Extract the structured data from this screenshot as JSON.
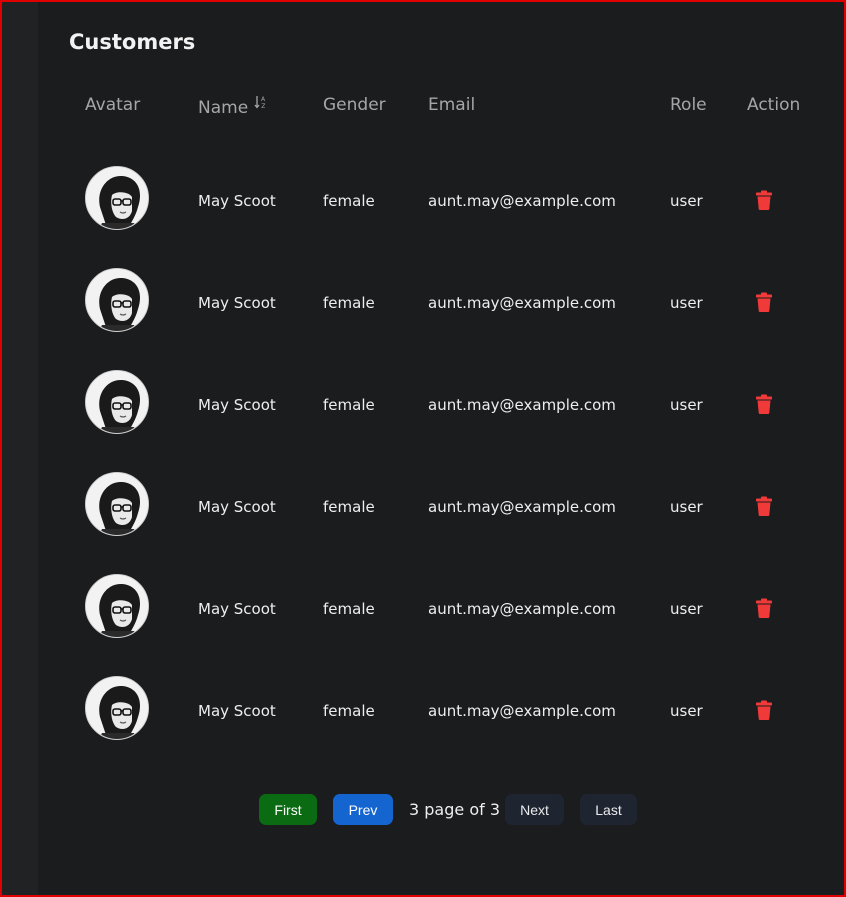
{
  "page": {
    "title": "Customers"
  },
  "table": {
    "headers": [
      "Avatar",
      "Name",
      "Gender",
      "Email",
      "Role",
      "Action"
    ],
    "rows": [
      {
        "name": "May Scoot",
        "gender": "female",
        "email": "aunt.may@example.com",
        "role": "user"
      },
      {
        "name": "May Scoot",
        "gender": "female",
        "email": "aunt.may@example.com",
        "role": "user"
      },
      {
        "name": "May Scoot",
        "gender": "female",
        "email": "aunt.may@example.com",
        "role": "user"
      },
      {
        "name": "May Scoot",
        "gender": "female",
        "email": "aunt.may@example.com",
        "role": "user"
      },
      {
        "name": "May Scoot",
        "gender": "female",
        "email": "aunt.may@example.com",
        "role": "user"
      },
      {
        "name": "May Scoot",
        "gender": "female",
        "email": "aunt.may@example.com",
        "role": "user"
      }
    ]
  },
  "pagination": {
    "first_label": "First",
    "prev_label": "Prev",
    "info": "3 page of 3",
    "next_label": "Next",
    "last_label": "Last"
  },
  "icons": {
    "sort": "sort-alpha-icon",
    "delete": "trash-icon"
  },
  "colors": {
    "background": "#1b1c1e",
    "delete": "#f03a3a",
    "first_button": "#0a6b12",
    "prev_button": "#1565d0",
    "nav_button": "#1e2531",
    "frame_border": "#e00000"
  }
}
